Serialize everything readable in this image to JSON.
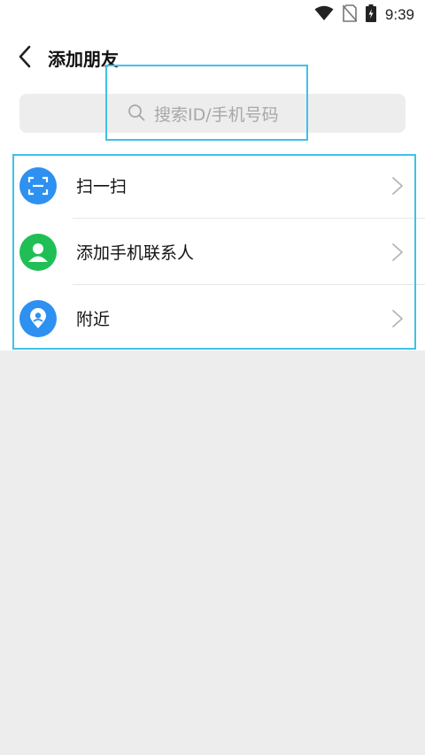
{
  "status": {
    "time": "9:39"
  },
  "header": {
    "title": "添加朋友"
  },
  "search": {
    "placeholder": "搜索ID/手机号码"
  },
  "items": [
    {
      "label": "扫一扫",
      "icon": "scan-icon",
      "color": "#2e90f0"
    },
    {
      "label": "添加手机联系人",
      "icon": "contact-icon",
      "color": "#1fbf55"
    },
    {
      "label": "附近",
      "icon": "location-icon",
      "color": "#2e90f0"
    }
  ]
}
